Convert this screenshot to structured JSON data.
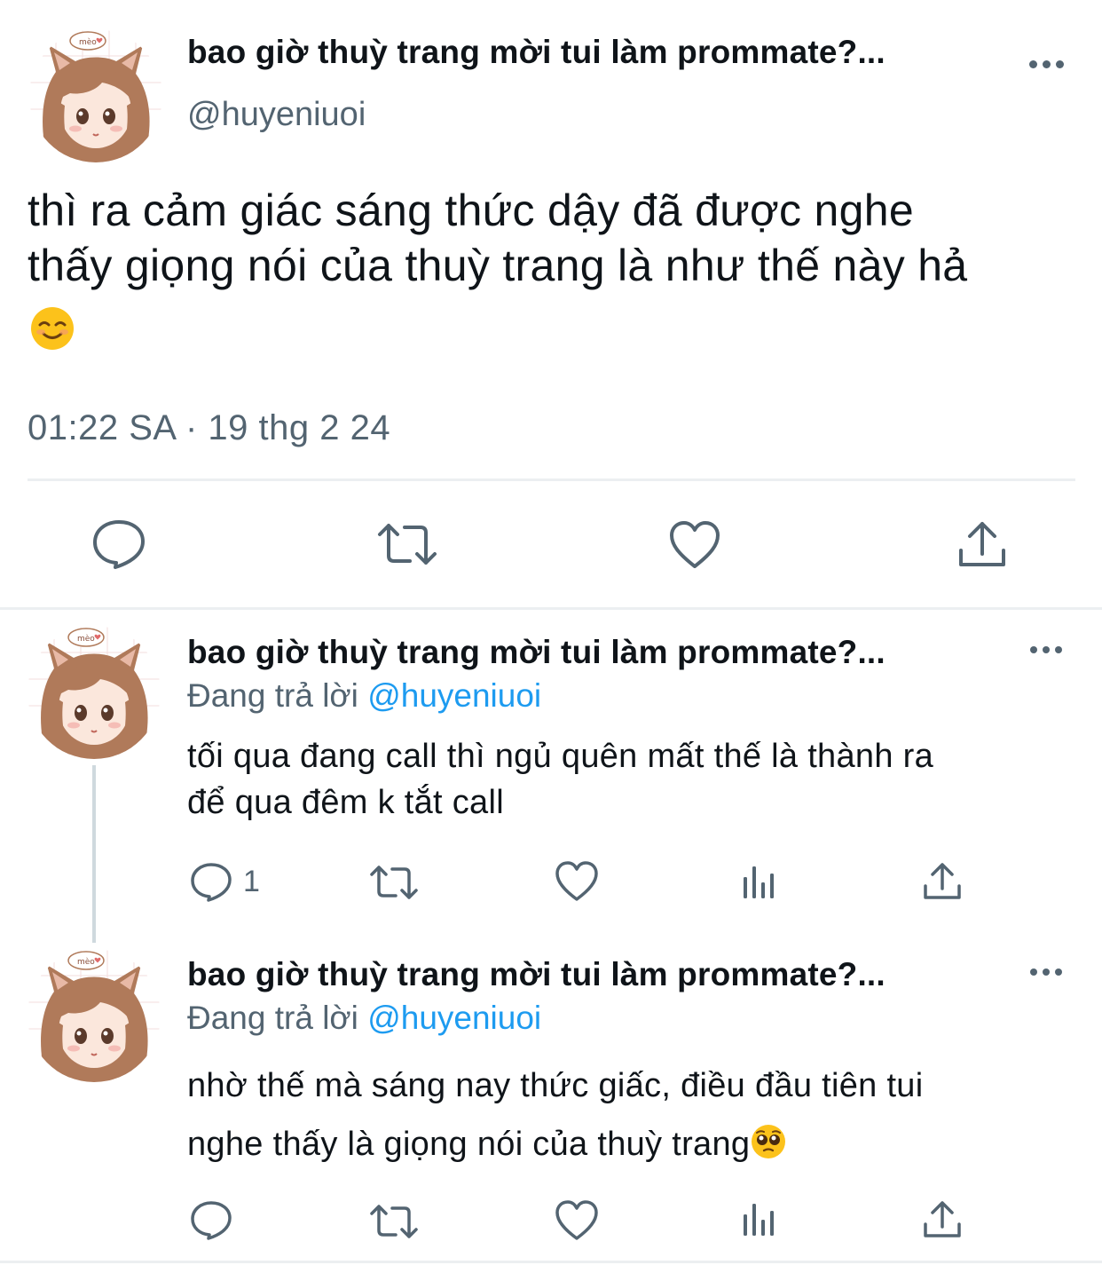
{
  "main_tweet": {
    "display_name": "bao giờ thuỳ trang mời tui làm prommate?...",
    "handle": "@huyeniuoi",
    "avatar_label": "mèo♥",
    "text_line1": "thì ra cảm giác sáng thức dậy đã được nghe",
    "text_line2": "thấy giọng nói của thuỳ trang là như thế này hả",
    "emoji": "smiling-face-emoji",
    "timestamp": "01:22 SA · 19 thg 2 24",
    "actions": [
      "reply-icon",
      "retweet-icon",
      "like-icon",
      "share-icon"
    ]
  },
  "replies": [
    {
      "display_name": "bao giờ thuỳ trang mời tui làm prommate?...",
      "replying_prefix": "Đang trả lời",
      "replying_handle": "@huyeniuoi",
      "avatar_label": "mèo♥",
      "text_line1": "tối qua đang call thì ngủ quên mất thế là thành ra",
      "text_line2": "để qua đêm k tắt call",
      "reply_count": "1",
      "actions": [
        "reply-icon",
        "retweet-icon",
        "like-icon",
        "views-icon",
        "share-icon"
      ]
    },
    {
      "display_name": "bao giờ thuỳ trang mời tui làm prommate?...",
      "replying_prefix": "Đang trả lời",
      "replying_handle": "@huyeniuoi",
      "avatar_label": "mèo♥",
      "text_line1": "nhờ thế mà sáng nay thức giấc, điều đầu tiên tui",
      "text_line2": "nghe thấy là giọng nói của thuỳ trang",
      "emoji": "pleading-face-emoji",
      "reply_count": "",
      "actions": [
        "reply-icon",
        "retweet-icon",
        "like-icon",
        "views-icon",
        "share-icon"
      ]
    }
  ],
  "colors": {
    "text": "#0f1419",
    "secondary": "#536471",
    "link": "#1d9bf0",
    "divider": "#eceff1",
    "avatar_hair": "#b07a5a"
  }
}
